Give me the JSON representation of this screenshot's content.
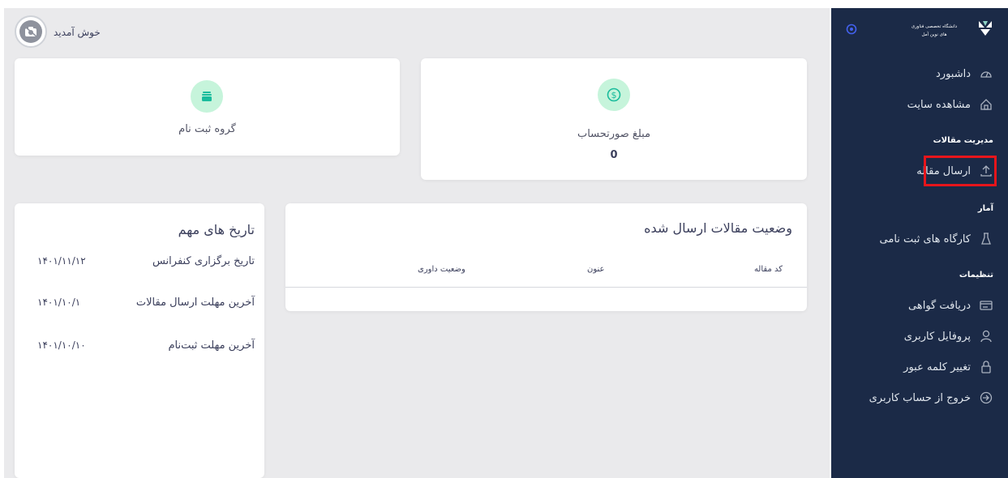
{
  "sidebar": {
    "logo_text_line1": "دانشگاه تخصصی فناوری",
    "logo_text_line2": "های نوین آمل",
    "items": [
      {
        "label": "داشبورد",
        "icon": "dashboard-icon"
      },
      {
        "label": "مشاهده سایت",
        "icon": "home-icon"
      },
      {
        "label": "ارسال مقاله",
        "icon": "upload-icon"
      },
      {
        "label": "کارگاه های ثبت نامی",
        "icon": "flask-icon"
      },
      {
        "label": "دریافت گواهی",
        "icon": "certificate-icon"
      },
      {
        "label": "پروفایل کاربری",
        "icon": "user-icon"
      },
      {
        "label": "تغییر کلمه عبور",
        "icon": "lock-icon"
      },
      {
        "label": "خروج از حساب کاربری",
        "icon": "logout-icon"
      }
    ],
    "sections": {
      "articles": "مدیریت مقالات",
      "stats": "آمار",
      "settings": "تنظیمات"
    },
    "highlight_color": "#e7151b"
  },
  "header": {
    "welcome": "خوش آمدید"
  },
  "cards": {
    "invoice": {
      "label": "مبلغ صورتحساب",
      "value": "0",
      "icon": "dollar-icon"
    },
    "registration_group": {
      "label": "گروه ثبت نام",
      "icon": "box-icon"
    }
  },
  "articles_status": {
    "title": "وضعیت مقالات ارسال شده",
    "columns": [
      "کد مقاله",
      "عنون",
      "وضعیت داوری"
    ]
  },
  "important_dates": {
    "title": "تاریخ های مهم",
    "rows": [
      {
        "label": "تاریخ برگزاری کنفرانس",
        "value": "۱۴۰۱/۱۱/۱۲"
      },
      {
        "label": "آخرین مهلت ارسال مقالات",
        "value": "۱۴۰۱/۱۰/۱"
      },
      {
        "label": "آخرین مهلت ثبت‌نام",
        "value": "۱۴۰۱/۱۰/۱۰"
      }
    ]
  },
  "colors": {
    "sidebar_bg": "#1b2a47",
    "accent_green": "#1abc9c",
    "icon_bg": "#c6f4db",
    "page_bg": "#eaeaec"
  }
}
